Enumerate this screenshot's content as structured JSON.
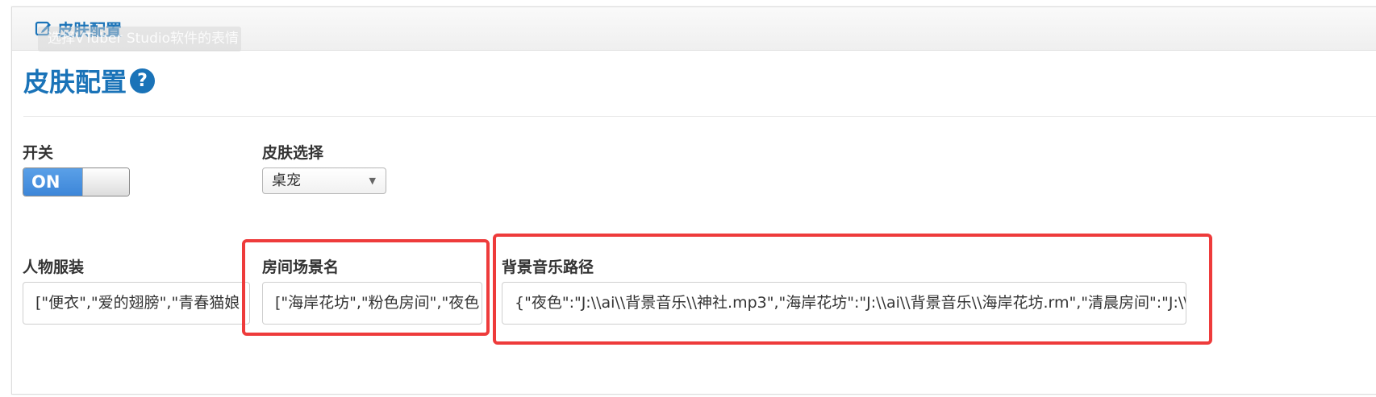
{
  "header": {
    "title": "皮肤配置",
    "tooltip": "选择VTuber Studio软件的表情"
  },
  "page": {
    "title": "皮肤配置",
    "help_icon": "?"
  },
  "fields": {
    "switch": {
      "label": "开关",
      "value": "ON"
    },
    "skin_select": {
      "label": "皮肤选择",
      "value": "桌宠"
    },
    "costume": {
      "label": "人物服装",
      "value": "[\"便衣\",\"爱的翅膀\",\"青春猫娘"
    },
    "room_scene": {
      "label": "房间场景名",
      "value": "[\"海岸花坊\",\"粉色房间\",\"夜色"
    },
    "bgm_path": {
      "label": "背景音乐路径",
      "value": "{\"夜色\":\"J:\\\\ai\\\\背景音乐\\\\神社.mp3\",\"海岸花坊\":\"J:\\\\ai\\\\背景音乐\\\\海岸花坊.rm\",\"清晨房间\":\"J:\\\\"
    }
  },
  "colors": {
    "accent": "#1a73b8",
    "highlight": "#ee3b3b",
    "switch_on": "#3d86d8"
  },
  "icons": [
    "edit-icon",
    "help-icon",
    "dropdown-arrow-icon"
  ]
}
